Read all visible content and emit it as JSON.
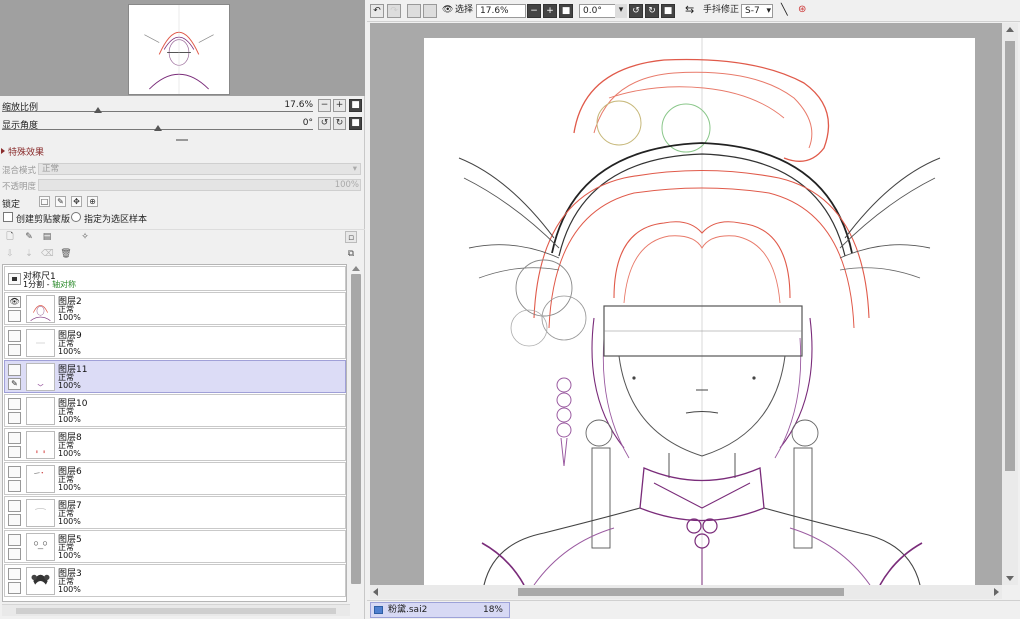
{
  "navigator": {
    "zoom_label": "缩放比例",
    "zoom_value": "17.6%",
    "zoom_fraction": 0.176,
    "angle_label": "显示角度",
    "angle_value": "0°",
    "angle_fraction": 0.5
  },
  "buttons": {
    "minus": "−",
    "plus": "+",
    "reset": "■",
    "rotate_left": "↺",
    "rotate_right": "↻"
  },
  "effects": {
    "header": "特殊效果",
    "blend_label": "混合模式",
    "blend_value": "正常",
    "opacity_label": "不透明度",
    "opacity_value": "100%"
  },
  "lock": {
    "label": "锁定",
    "icons": [
      "□",
      "✎",
      "✥",
      "⊕"
    ]
  },
  "options": {
    "clipping_label": "创建剪贴蒙版",
    "sample_label": "指定为选区样本"
  },
  "layers": {
    "ruler": {
      "name": "对称尺1",
      "sub_prefix": "1分割 - ",
      "sub_status": "轴对称"
    },
    "items": [
      {
        "name": "图层2",
        "mode": "正常",
        "opacity": "100%",
        "visible": true,
        "selected": false
      },
      {
        "name": "图层9",
        "mode": "正常",
        "opacity": "100%",
        "visible": false,
        "selected": false
      },
      {
        "name": "图层11",
        "mode": "正常",
        "opacity": "100%",
        "visible": false,
        "selected": true
      },
      {
        "name": "图层10",
        "mode": "正常",
        "opacity": "100%",
        "visible": false,
        "selected": false
      },
      {
        "name": "图层8",
        "mode": "正常",
        "opacity": "100%",
        "visible": false,
        "selected": false
      },
      {
        "name": "图层6",
        "mode": "正常",
        "opacity": "100%",
        "visible": false,
        "selected": false
      },
      {
        "name": "图层7",
        "mode": "正常",
        "opacity": "100%",
        "visible": false,
        "selected": false
      },
      {
        "name": "图层5",
        "mode": "正常",
        "opacity": "100%",
        "visible": false,
        "selected": false
      },
      {
        "name": "图层3",
        "mode": "正常",
        "opacity": "100%",
        "visible": false,
        "selected": false
      }
    ]
  },
  "toolbar": {
    "select_label": "选择",
    "zoom_value": "17.6%",
    "angle_value": "0.0°",
    "stabilizer_label": "手抖修正",
    "stabilizer_value": "S-7"
  },
  "document": {
    "tab_name": "粉黛.sai2",
    "tab_zoom": "18%"
  },
  "colors": {
    "selected_layer": "#dcdcf6",
    "section_header": "#8a2c2c",
    "sketch_red": "#e05a4a",
    "sketch_purple": "#7a2c7a"
  }
}
